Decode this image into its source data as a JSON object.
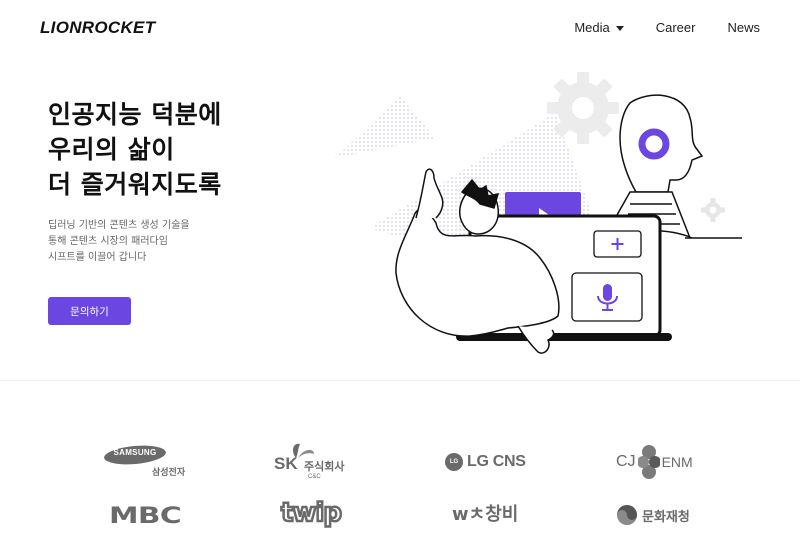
{
  "header": {
    "logo": "LIONROCKET",
    "nav": [
      {
        "label": "Media",
        "has_dropdown": true
      },
      {
        "label": "Career",
        "has_dropdown": false
      },
      {
        "label": "News",
        "has_dropdown": false
      }
    ]
  },
  "hero": {
    "title_lines": [
      "인공지능 덕분에",
      "우리의 삶이",
      "더 즐거워지도록"
    ],
    "subtitle_lines": [
      "딥러닝 기반의 콘텐츠 생성 기술을",
      "통해 콘텐츠 시장의 패러다임",
      "시프트를 이끌어 갑니다"
    ],
    "cta_label": "문의하기"
  },
  "partners": {
    "samsung": {
      "wordmark": "SAMSUNG",
      "caption": "삼성전자"
    },
    "sk": {
      "mark": "SK",
      "caption": "주식회사",
      "sub": "C&C"
    },
    "lgcns": {
      "mark": "LG",
      "text": "LG CNS"
    },
    "cjenm": {
      "left": "CJ",
      "right": "ENM"
    },
    "mbc": {
      "text": "MBC"
    },
    "twip": {
      "text": "twip"
    },
    "wechangbi": {
      "text": "wㅊ창비"
    },
    "mcst": {
      "text": "문화재청"
    }
  },
  "colors": {
    "accent": "#6b46e0",
    "dark": "#111111",
    "logo_gray": "#6a6a6a"
  },
  "icons": [
    "caret-down-icon",
    "play-icon",
    "plus-icon",
    "microphone-icon",
    "gear-icon"
  ]
}
